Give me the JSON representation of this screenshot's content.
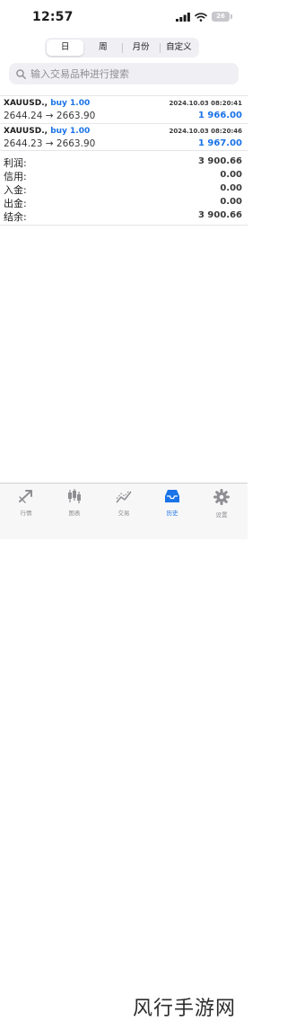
{
  "status": {
    "time": "12:57",
    "battery": "26"
  },
  "period_tabs": [
    {
      "label": "日",
      "active": true
    },
    {
      "label": "周",
      "active": false
    },
    {
      "label": "月份",
      "active": false
    },
    {
      "label": "自定义",
      "active": false
    }
  ],
  "search": {
    "placeholder": "输入交易品种进行搜索"
  },
  "trades": [
    {
      "symbol": "XAUUSD.,",
      "side": "buy 1.00",
      "time": "2024.10.03 08:20:41",
      "prices": "2644.24 → 2663.90",
      "profit": "1 966.00"
    },
    {
      "symbol": "XAUUSD.,",
      "side": "buy 1.00",
      "time": "2024.10.03 08:20:46",
      "prices": "2644.23 → 2663.90",
      "profit": "1 967.00"
    }
  ],
  "summary": [
    {
      "label": "利润:",
      "value": "3 900.66"
    },
    {
      "label": "信用:",
      "value": "0.00"
    },
    {
      "label": "入金:",
      "value": "0.00"
    },
    {
      "label": "出金:",
      "value": "0.00"
    },
    {
      "label": "结余:",
      "value": "3 900.66"
    }
  ],
  "tabbar": [
    {
      "label": "行情",
      "icon": "quotes-icon"
    },
    {
      "label": "图表",
      "icon": "chart-icon"
    },
    {
      "label": "交易",
      "icon": "trade-icon"
    },
    {
      "label": "历史",
      "icon": "history-icon",
      "active": true
    },
    {
      "label": "设置",
      "icon": "gear-icon"
    }
  ],
  "watermark": "风行手游网",
  "colors": {
    "accent": "#1a73e8",
    "segment_bg": "#efeff4"
  }
}
